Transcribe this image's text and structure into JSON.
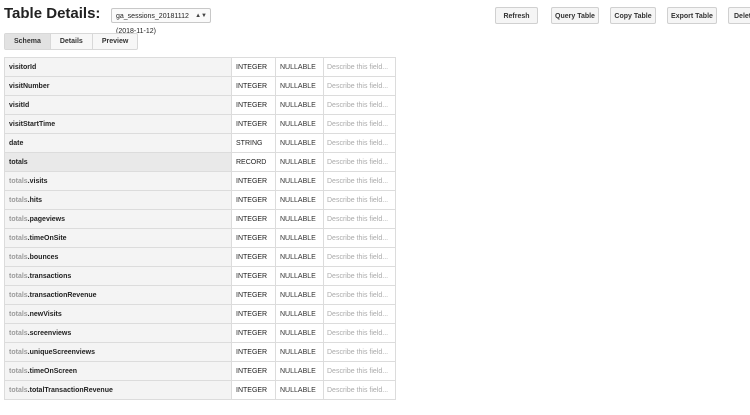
{
  "header": {
    "title": "Table Details:",
    "table_select": "ga_sessions_20181112 (2018-11-12)",
    "buttons": [
      "Refresh",
      "Query Table",
      "Copy Table",
      "Export Table",
      "Delet"
    ]
  },
  "tabs": [
    {
      "label": "Schema",
      "active": true
    },
    {
      "label": "Details",
      "active": false
    },
    {
      "label": "Preview",
      "active": false
    }
  ],
  "schema": {
    "description_placeholder": "Describe this field...",
    "rows": [
      {
        "parent": "",
        "name": "visitorId",
        "type": "INTEGER",
        "mode": "NULLABLE"
      },
      {
        "parent": "",
        "name": "visitNumber",
        "type": "INTEGER",
        "mode": "NULLABLE"
      },
      {
        "parent": "",
        "name": "visitId",
        "type": "INTEGER",
        "mode": "NULLABLE"
      },
      {
        "parent": "",
        "name": "visitStartTime",
        "type": "INTEGER",
        "mode": "NULLABLE"
      },
      {
        "parent": "",
        "name": "date",
        "type": "STRING",
        "mode": "NULLABLE"
      },
      {
        "parent": "",
        "name": "totals",
        "type": "RECORD",
        "mode": "NULLABLE"
      },
      {
        "parent": "totals",
        "name": ".visits",
        "type": "INTEGER",
        "mode": "NULLABLE"
      },
      {
        "parent": "totals",
        "name": ".hits",
        "type": "INTEGER",
        "mode": "NULLABLE"
      },
      {
        "parent": "totals",
        "name": ".pageviews",
        "type": "INTEGER",
        "mode": "NULLABLE"
      },
      {
        "parent": "totals",
        "name": ".timeOnSite",
        "type": "INTEGER",
        "mode": "NULLABLE"
      },
      {
        "parent": "totals",
        "name": ".bounces",
        "type": "INTEGER",
        "mode": "NULLABLE"
      },
      {
        "parent": "totals",
        "name": ".transactions",
        "type": "INTEGER",
        "mode": "NULLABLE"
      },
      {
        "parent": "totals",
        "name": ".transactionRevenue",
        "type": "INTEGER",
        "mode": "NULLABLE"
      },
      {
        "parent": "totals",
        "name": ".newVisits",
        "type": "INTEGER",
        "mode": "NULLABLE"
      },
      {
        "parent": "totals",
        "name": ".screenviews",
        "type": "INTEGER",
        "mode": "NULLABLE"
      },
      {
        "parent": "totals",
        "name": ".uniqueScreenviews",
        "type": "INTEGER",
        "mode": "NULLABLE"
      },
      {
        "parent": "totals",
        "name": ".timeOnScreen",
        "type": "INTEGER",
        "mode": "NULLABLE"
      },
      {
        "parent": "totals",
        "name": ".totalTransactionRevenue",
        "type": "INTEGER",
        "mode": "NULLABLE"
      }
    ]
  }
}
